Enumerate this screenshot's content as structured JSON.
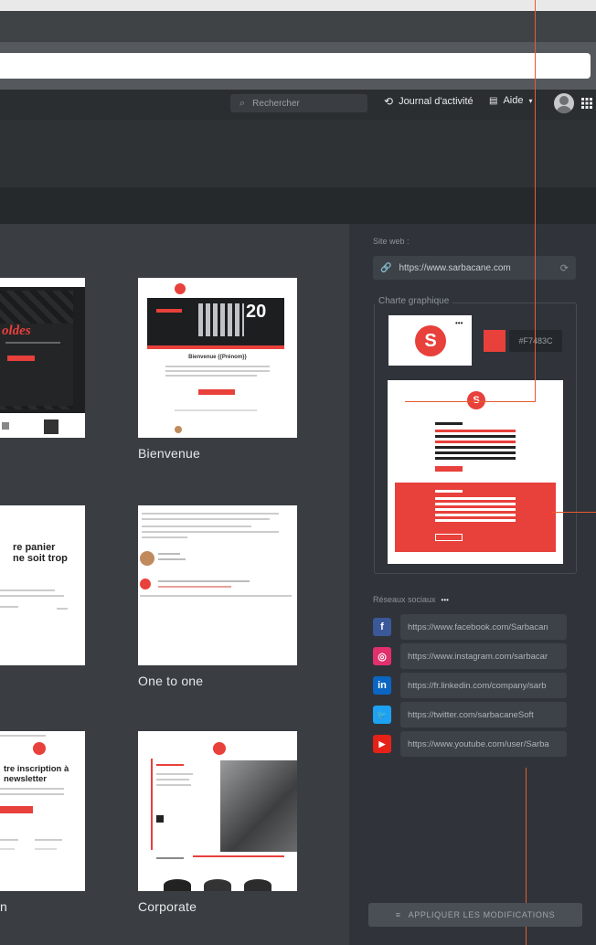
{
  "appbar": {
    "search_placeholder": "Rechercher",
    "activity_label": "Journal d'activité",
    "help_label": "Aide",
    "help_caret": "▾"
  },
  "templates": [
    {
      "name": "",
      "promo_text": "oldes"
    },
    {
      "name": "Bienvenue",
      "headline": "Bienvenue {{Prénom}}",
      "badge": "20"
    },
    {
      "name": "",
      "headline": "re panier\nne soit trop"
    },
    {
      "name": "One to one"
    },
    {
      "name": "n",
      "headline": "tre inscription à\nnewsletter"
    },
    {
      "name": "Corporate"
    }
  ],
  "panel": {
    "site_label": "Site web :",
    "site_url": "https://www.sarbacane.com",
    "charte_label": "Charte graphique",
    "color_hex": "#F7483C",
    "social_label": "Réseaux sociaux",
    "more_glyph": "•••",
    "apply_label": "APPLIQUER LES MODIFICATIONS"
  },
  "socials": [
    {
      "icon": "facebook-icon",
      "glyph": "f",
      "color": "#3b5998",
      "url": "https://www.facebook.com/Sarbacan"
    },
    {
      "icon": "instagram-icon",
      "glyph": "◎",
      "color": "#e1306c",
      "url": "https://www.instagram.com/sarbacar"
    },
    {
      "icon": "linkedin-icon",
      "glyph": "in",
      "color": "#0a66c2",
      "url": "https://fr.linkedin.com/company/sarb"
    },
    {
      "icon": "twitter-icon",
      "glyph": "🐦",
      "color": "#1da1f2",
      "url": "https://twitter.com/sarbacaneSoft"
    },
    {
      "icon": "youtube-icon",
      "glyph": "▶",
      "color": "#e62117",
      "url": "https://www.youtube.com/user/Sarba"
    }
  ],
  "colors": {
    "accent": "#e8403b",
    "callout": "#e85a2c",
    "panel_bg": "#30343a",
    "content_bg": "#3a3e42"
  }
}
